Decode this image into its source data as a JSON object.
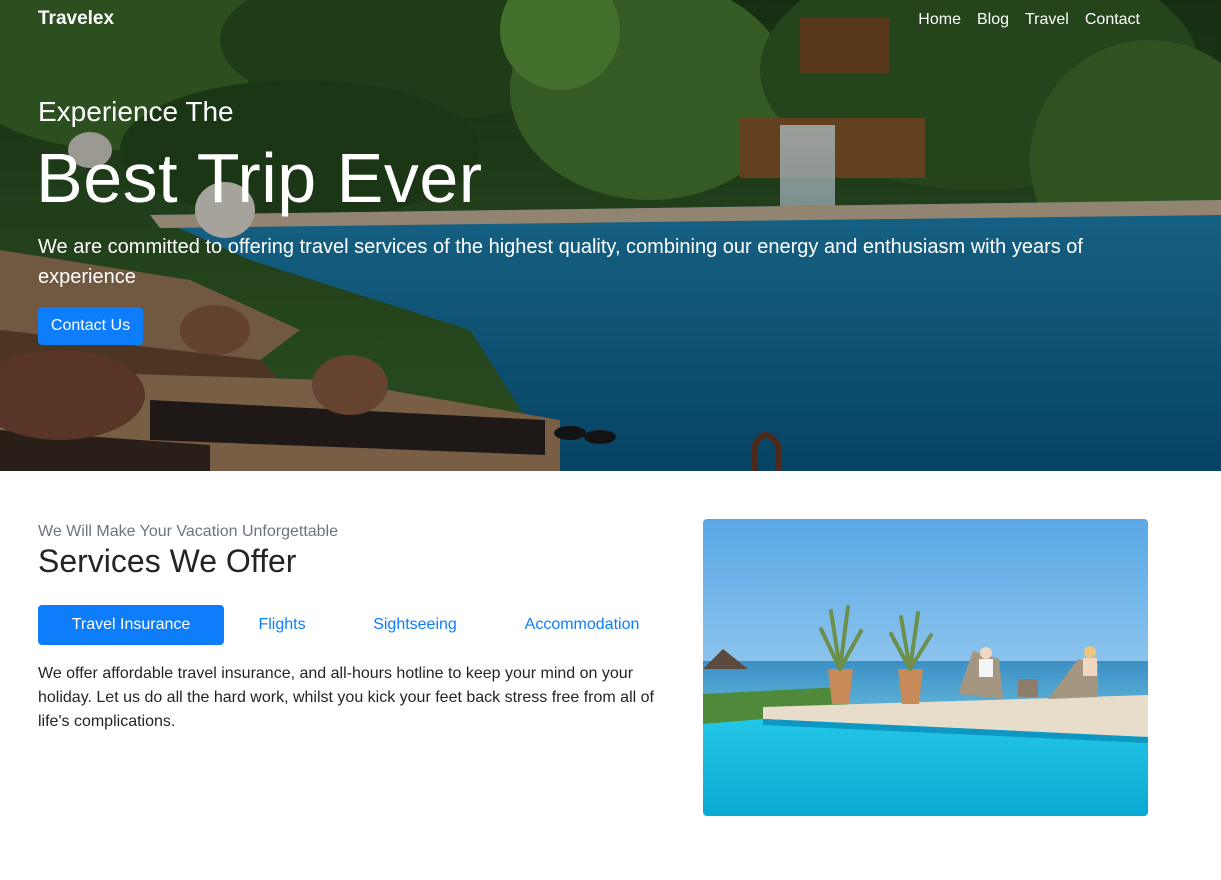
{
  "nav": {
    "brand": "Travelex",
    "links": [
      "Home",
      "Blog",
      "Travel",
      "Contact"
    ]
  },
  "hero": {
    "kicker": "Experience The",
    "title": "Best Trip Ever",
    "description": "We are committed to offering travel services of the highest quality, combining our energy and enthusiasm with years of experience",
    "button_label": "Contact Us",
    "image": "resort-pool-photo"
  },
  "services": {
    "kicker": "We Will Make Your Vacation Unforgettable",
    "title": "Services We Offer",
    "tabs": [
      {
        "label": "Travel Insurance",
        "active": true
      },
      {
        "label": "Flights",
        "active": false
      },
      {
        "label": "Sightseeing",
        "active": false
      },
      {
        "label": "Accommodation",
        "active": false
      }
    ],
    "text": "We offer affordable travel insurance, and all-hours hotline to keep your mind on your holiday. Let us do all the hard work, whilst you kick your feet back stress free from all of life's complications.",
    "image": "infinity-pool-ocean-photo"
  },
  "colors": {
    "accent": "#0d7dfb",
    "muted_text": "#6c757d",
    "body_text": "#212529"
  }
}
